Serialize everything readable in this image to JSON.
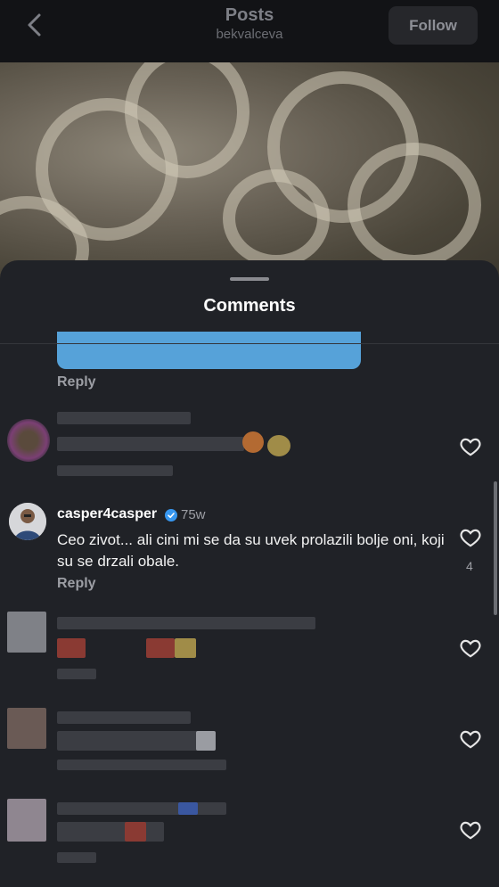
{
  "header": {
    "title": "Posts",
    "username": "bekvalceva",
    "follow_label": "Follow"
  },
  "sheet": {
    "title": "Comments"
  },
  "reply_label": "Reply",
  "comments": [
    {
      "id": "blurred-1",
      "blurred": true
    },
    {
      "id": "main",
      "username": "casper4casper",
      "verified": true,
      "time": "75w",
      "text": "Ceo zivot... ali cini mi se da su uvek prolazili bolje oni, koji su se drzali obale.",
      "likes": "4",
      "reply_label": "Reply"
    },
    {
      "id": "blurred-2",
      "blurred": true
    },
    {
      "id": "blurred-3",
      "blurred": true
    },
    {
      "id": "blurred-4",
      "blurred": true
    }
  ],
  "icons": {
    "back": "chevron-left-icon",
    "like": "heart-outline-icon",
    "verified": "verified-badge-icon"
  },
  "colors": {
    "accent": "#56a2d9",
    "verified": "#3797f0",
    "sheet": "#202227"
  }
}
